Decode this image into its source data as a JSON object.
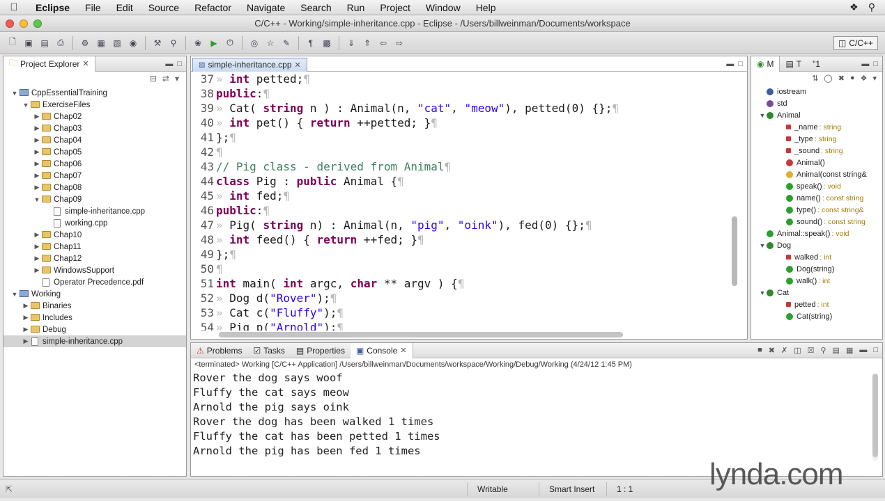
{
  "menubar": {
    "items": [
      "Eclipse",
      "File",
      "Edit",
      "Source",
      "Refactor",
      "Navigate",
      "Search",
      "Run",
      "Project",
      "Window",
      "Help"
    ]
  },
  "window": {
    "title": "C/C++ - Working/simple-inheritance.cpp - Eclipse - /Users/billweinman/Documents/workspace"
  },
  "toolbar": {
    "perspective_label": "C/C++"
  },
  "explorer": {
    "tab_label": "Project Explorer",
    "tree": [
      {
        "label": "CppEssentialTraining",
        "depth": 0,
        "expanded": true,
        "icon": "project"
      },
      {
        "label": "ExerciseFiles",
        "depth": 1,
        "expanded": true,
        "icon": "folder"
      },
      {
        "label": "Chap02",
        "depth": 2,
        "expanded": false,
        "icon": "folder"
      },
      {
        "label": "Chap03",
        "depth": 2,
        "expanded": false,
        "icon": "folder"
      },
      {
        "label": "Chap04",
        "depth": 2,
        "expanded": false,
        "icon": "folder"
      },
      {
        "label": "Chap05",
        "depth": 2,
        "expanded": false,
        "icon": "folder"
      },
      {
        "label": "Chap06",
        "depth": 2,
        "expanded": false,
        "icon": "folder"
      },
      {
        "label": "Chap07",
        "depth": 2,
        "expanded": false,
        "icon": "folder"
      },
      {
        "label": "Chap08",
        "depth": 2,
        "expanded": false,
        "icon": "folder"
      },
      {
        "label": "Chap09",
        "depth": 2,
        "expanded": true,
        "icon": "folder"
      },
      {
        "label": "simple-inheritance.cpp",
        "depth": 3,
        "expanded": null,
        "icon": "file"
      },
      {
        "label": "working.cpp",
        "depth": 3,
        "expanded": null,
        "icon": "file"
      },
      {
        "label": "Chap10",
        "depth": 2,
        "expanded": false,
        "icon": "folder"
      },
      {
        "label": "Chap11",
        "depth": 2,
        "expanded": false,
        "icon": "folder"
      },
      {
        "label": "Chap12",
        "depth": 2,
        "expanded": false,
        "icon": "folder"
      },
      {
        "label": "WindowsSupport",
        "depth": 2,
        "expanded": false,
        "icon": "folder"
      },
      {
        "label": "Operator Precedence.pdf",
        "depth": 2,
        "expanded": null,
        "icon": "file"
      },
      {
        "label": "Working",
        "depth": 0,
        "expanded": true,
        "icon": "project"
      },
      {
        "label": "Binaries",
        "depth": 1,
        "expanded": false,
        "icon": "folder"
      },
      {
        "label": "Includes",
        "depth": 1,
        "expanded": false,
        "icon": "folder"
      },
      {
        "label": "Debug",
        "depth": 1,
        "expanded": false,
        "icon": "folder"
      },
      {
        "label": "simple-inheritance.cpp",
        "depth": 1,
        "expanded": false,
        "icon": "file",
        "selected": true
      }
    ]
  },
  "editor": {
    "tab_label": "simple-inheritance.cpp",
    "lines": [
      {
        "num": "37",
        "tokens": [
          [
            "pil",
            "» "
          ],
          [
            "kw",
            "int"
          ],
          [
            "txt",
            " petted;"
          ],
          [
            "pil",
            "¶"
          ]
        ]
      },
      {
        "num": "38",
        "tokens": [
          [
            "kw",
            "public"
          ],
          [
            "txt",
            ":"
          ],
          [
            "pil",
            "¶"
          ]
        ]
      },
      {
        "num": "39",
        "tokens": [
          [
            "pil",
            "» "
          ],
          [
            "txt",
            "Cat( "
          ],
          [
            "kw",
            "string"
          ],
          [
            "txt",
            " n ) : Animal(n, "
          ],
          [
            "str",
            "\"cat\""
          ],
          [
            "txt",
            ", "
          ],
          [
            "str",
            "\"meow\""
          ],
          [
            "txt",
            "), petted(0) {};"
          ],
          [
            "pil",
            "¶"
          ]
        ]
      },
      {
        "num": "40",
        "tokens": [
          [
            "pil",
            "» "
          ],
          [
            "kw",
            "int"
          ],
          [
            "txt",
            " pet() { "
          ],
          [
            "kw",
            "return"
          ],
          [
            "txt",
            " ++petted; }"
          ],
          [
            "pil",
            "¶"
          ]
        ]
      },
      {
        "num": "41",
        "tokens": [
          [
            "txt",
            "};"
          ],
          [
            "pil",
            "¶"
          ]
        ]
      },
      {
        "num": "42",
        "tokens": [
          [
            "pil",
            "¶"
          ]
        ]
      },
      {
        "num": "43",
        "tokens": [
          [
            "cmt",
            "// Pig class - derived from Animal"
          ],
          [
            "pil",
            "¶"
          ]
        ]
      },
      {
        "num": "44",
        "tokens": [
          [
            "kw",
            "class"
          ],
          [
            "txt",
            " Pig : "
          ],
          [
            "kw",
            "public"
          ],
          [
            "txt",
            " Animal {"
          ],
          [
            "pil",
            "¶"
          ]
        ]
      },
      {
        "num": "45",
        "tokens": [
          [
            "pil",
            "» "
          ],
          [
            "kw",
            "int"
          ],
          [
            "txt",
            " fed;"
          ],
          [
            "pil",
            "¶"
          ]
        ]
      },
      {
        "num": "46",
        "tokens": [
          [
            "kw",
            "public"
          ],
          [
            "txt",
            ":"
          ],
          [
            "pil",
            "¶"
          ]
        ]
      },
      {
        "num": "47",
        "tokens": [
          [
            "pil",
            "» "
          ],
          [
            "txt",
            "Pig( "
          ],
          [
            "kw",
            "string"
          ],
          [
            "txt",
            " n) : Animal(n, "
          ],
          [
            "str",
            "\"pig\""
          ],
          [
            "txt",
            ", "
          ],
          [
            "str",
            "\"oink\""
          ],
          [
            "txt",
            "), fed(0) {};"
          ],
          [
            "pil",
            "¶"
          ]
        ]
      },
      {
        "num": "48",
        "tokens": [
          [
            "pil",
            "» "
          ],
          [
            "kw",
            "int"
          ],
          [
            "txt",
            " feed() { "
          ],
          [
            "kw",
            "return"
          ],
          [
            "txt",
            " ++fed; }"
          ],
          [
            "pil",
            "¶"
          ]
        ]
      },
      {
        "num": "49",
        "tokens": [
          [
            "txt",
            "};"
          ],
          [
            "pil",
            "¶"
          ]
        ]
      },
      {
        "num": "50",
        "tokens": [
          [
            "pil",
            "¶"
          ]
        ]
      },
      {
        "num": "51",
        "tokens": [
          [
            "kw",
            "int"
          ],
          [
            "txt",
            " main( "
          ],
          [
            "kw",
            "int"
          ],
          [
            "txt",
            " argc, "
          ],
          [
            "kw",
            "char"
          ],
          [
            "txt",
            " ** argv ) {"
          ],
          [
            "pil",
            "¶"
          ]
        ]
      },
      {
        "num": "52",
        "tokens": [
          [
            "pil",
            "» "
          ],
          [
            "txt",
            "Dog d("
          ],
          [
            "str",
            "\"Rover\""
          ],
          [
            "txt",
            ");"
          ],
          [
            "pil",
            "¶"
          ]
        ]
      },
      {
        "num": "53",
        "tokens": [
          [
            "pil",
            "» "
          ],
          [
            "txt",
            "Cat c("
          ],
          [
            "str",
            "\"Fluffy\""
          ],
          [
            "txt",
            ");"
          ],
          [
            "pil",
            "¶"
          ]
        ]
      },
      {
        "num": "54",
        "tokens": [
          [
            "pil",
            "» "
          ],
          [
            "txt",
            "Pig p("
          ],
          [
            "str",
            "\"Arnold\""
          ],
          [
            "txt",
            ");"
          ],
          [
            "pil",
            "¶"
          ]
        ]
      }
    ]
  },
  "outline": {
    "tabs": [
      "M",
      "T",
      "\"1"
    ],
    "items": [
      {
        "label": "iostream",
        "type": "",
        "depth": 0,
        "kind": "include"
      },
      {
        "label": "std",
        "type": "",
        "depth": 0,
        "kind": "namespace"
      },
      {
        "label": "Animal",
        "type": "",
        "depth": 0,
        "kind": "class",
        "expanded": true
      },
      {
        "label": "_name",
        "type": ": string",
        "depth": 1,
        "kind": "private-field"
      },
      {
        "label": "_type",
        "type": ": string",
        "depth": 1,
        "kind": "private-field"
      },
      {
        "label": "_sound",
        "type": ": string",
        "depth": 1,
        "kind": "private-field"
      },
      {
        "label": "Animal()",
        "type": "",
        "depth": 1,
        "kind": "private-method"
      },
      {
        "label": "Animal(const string&",
        "type": "",
        "depth": 1,
        "kind": "protected-method"
      },
      {
        "label": "speak()",
        "type": ": void",
        "depth": 1,
        "kind": "public-method"
      },
      {
        "label": "name()",
        "type": ": const string",
        "depth": 1,
        "kind": "public-method"
      },
      {
        "label": "type()",
        "type": ": const string&",
        "depth": 1,
        "kind": "public-method"
      },
      {
        "label": "sound()",
        "type": ": const string",
        "depth": 1,
        "kind": "public-method"
      },
      {
        "label": "Animal::speak()",
        "type": ": void",
        "depth": 0,
        "kind": "public-method"
      },
      {
        "label": "Dog",
        "type": "",
        "depth": 0,
        "kind": "class",
        "expanded": true
      },
      {
        "label": "walked",
        "type": ": int",
        "depth": 1,
        "kind": "private-field"
      },
      {
        "label": "Dog(string)",
        "type": "",
        "depth": 1,
        "kind": "public-method"
      },
      {
        "label": "walk()",
        "type": ": int",
        "depth": 1,
        "kind": "public-method"
      },
      {
        "label": "Cat",
        "type": "",
        "depth": 0,
        "kind": "class",
        "expanded": true
      },
      {
        "label": "petted",
        "type": ": int",
        "depth": 1,
        "kind": "private-field"
      },
      {
        "label": "Cat(string)",
        "type": "",
        "depth": 1,
        "kind": "public-method"
      }
    ]
  },
  "console": {
    "tabs": [
      "Problems",
      "Tasks",
      "Properties",
      "Console"
    ],
    "status": "<terminated> Working [C/C++ Application] /Users/billweinman/Documents/workspace/Working/Debug/Working (4/24/12 1:45 PM)",
    "output": [
      "Rover the dog says woof",
      "Fluffy the cat says meow",
      "Arnold the pig says oink",
      "Rover the dog has been walked 1 times",
      "Fluffy the cat has been petted 1 times",
      "Arnold the pig has been fed 1 times"
    ]
  },
  "statusbar": {
    "writable": "Writable",
    "insert_mode": "Smart Insert",
    "position": "1 : 1"
  },
  "watermark": "lynda.com",
  "colors": {
    "keyword": "#7f0055",
    "string": "#2a00ff",
    "comment": "#3f7f5f",
    "pilcrow": "#b8b8b8",
    "selection": "#d4d4d4"
  }
}
